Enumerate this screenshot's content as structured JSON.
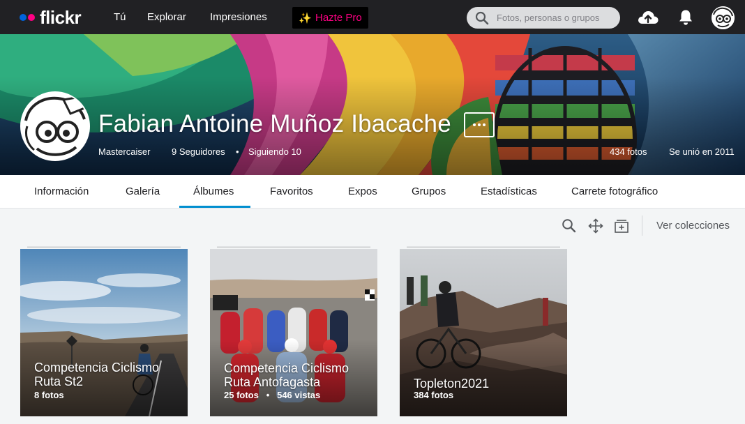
{
  "nav": {
    "logo": "flickr",
    "links": [
      "Tú",
      "Explorar",
      "Impresiones"
    ],
    "pro_label": "Hazte Pro",
    "search_placeholder": "Fotos, personas o grupos"
  },
  "profile": {
    "name": "Fabian Antoine Muñoz Ibacache",
    "username": "Mastercaiser",
    "followers": "9 Seguidores",
    "following": "Siguiendo 10",
    "photo_count": "434 fotos",
    "joined": "Se unió en 2011"
  },
  "tabs": [
    "Información",
    "Galería",
    "Álbumes",
    "Favoritos",
    "Expos",
    "Grupos",
    "Estadísticas",
    "Carrete fotográfico"
  ],
  "active_tab": "Álbumes",
  "toolbar": {
    "icons": [
      "search-icon",
      "arrange-icon",
      "add-album-icon"
    ],
    "collections_label": "Ver colecciones"
  },
  "albums": [
    {
      "title": "Competencia Ciclismo Ruta St2",
      "photos": "8 fotos",
      "views": ""
    },
    {
      "title": "Competencia Ciclismo Ruta Antofagasta",
      "photos": "25 fotos",
      "views": "546 vistas"
    },
    {
      "title": "Topleton2021",
      "photos": "384 fotos",
      "views": ""
    }
  ],
  "colors": {
    "nav_bg": "#212124",
    "pro_text": "#ff0084",
    "logo_blue": "#0063dc",
    "logo_pink": "#ff0084",
    "tab_underline": "#008ecf",
    "page_bg": "#f3f5f6"
  }
}
